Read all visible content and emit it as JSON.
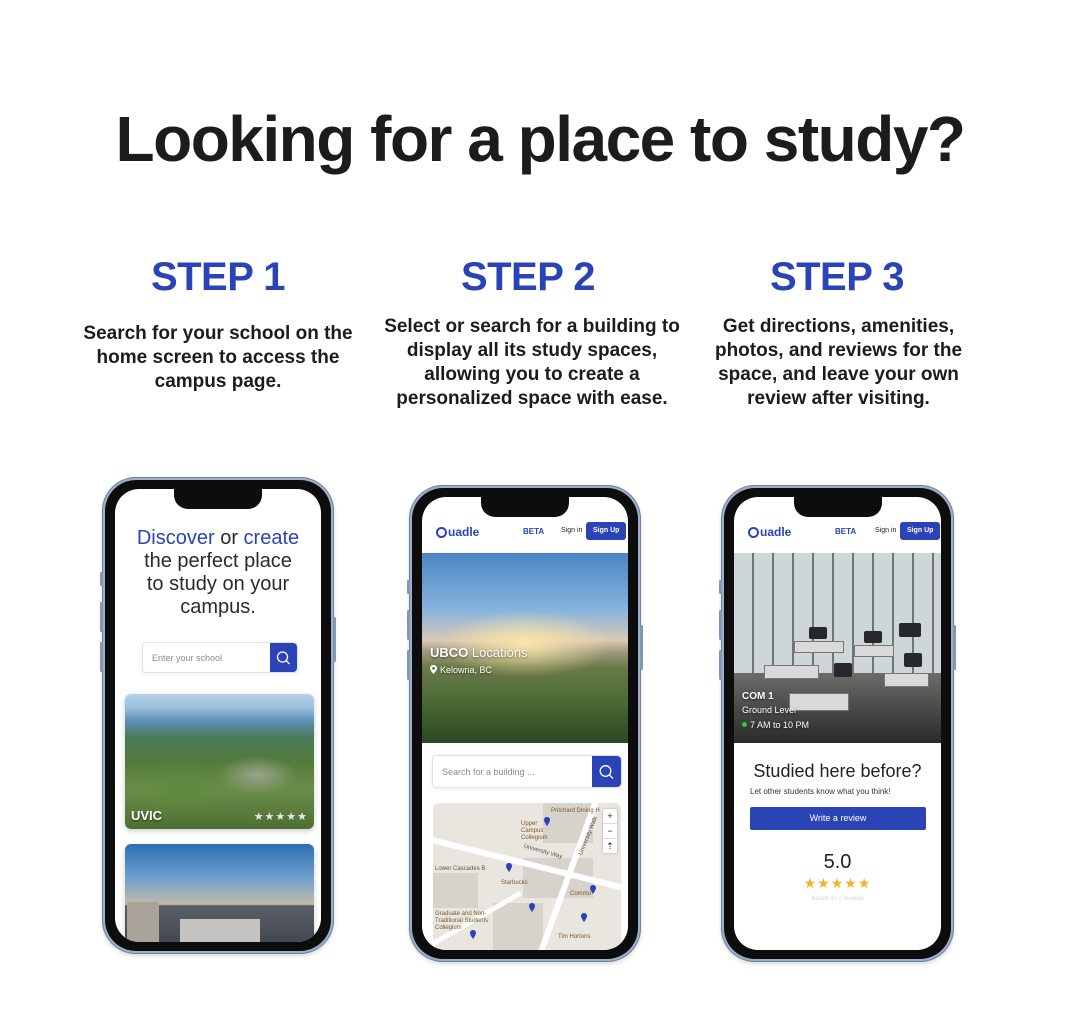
{
  "headline": "Looking for a place to study?",
  "colors": {
    "brand_blue": "#2a44b8",
    "text_dark": "#1c1c1c",
    "star": "#f4b226"
  },
  "steps": [
    {
      "title": "STEP 1",
      "description": "Search for your school on the home screen to access the campus page."
    },
    {
      "title": "STEP 2",
      "description": "Select or search for a building to display all its study spaces, allowing you to create a personalized space with ease."
    },
    {
      "title": "STEP 3",
      "description": "Get directions, amenities, photos, and reviews for the space, and leave your own review after visiting."
    }
  ],
  "phone1": {
    "hero_discover": "Discover",
    "hero_or": " or ",
    "hero_create": "create",
    "hero_rest": "the perfect place to study on your campus.",
    "search_placeholder": "Enter your school",
    "search_icon": "search-icon",
    "campuses": [
      {
        "name": "UVIC",
        "stars": "★★★★★"
      },
      {
        "name": ""
      }
    ]
  },
  "app": {
    "logo": "uadle",
    "beta": "BETA",
    "signin": "Sign in",
    "signup": "Sign Up"
  },
  "phone2": {
    "campus_code": "UBCO",
    "campus_suffix": " Locations",
    "location": "Kelowna, BC",
    "location_icon": "map-pin-icon",
    "search_placeholder": "Search for a building ...",
    "map_labels": [
      "Pritchard Dining H",
      "Upper Campus Collegium",
      "University Way",
      "University Walk",
      "Lower Cascades B",
      "Starbucks",
      "Commo",
      "Graduate and Non-Traditional Students Collegium",
      "Tim Hortons"
    ],
    "zoom_in": "+",
    "zoom_out": "−",
    "compass": "⇡"
  },
  "phone3": {
    "space_name": "COM 1",
    "level": "Ground Level",
    "hours": "7 AM to 10 PM",
    "prompt": "Studied here before?",
    "prompt_sub": "Let other students know what you think!",
    "review_button": "Write a review",
    "score": "5.0",
    "stars": "★★★★★",
    "based_on": "Based on 2 reviews"
  }
}
